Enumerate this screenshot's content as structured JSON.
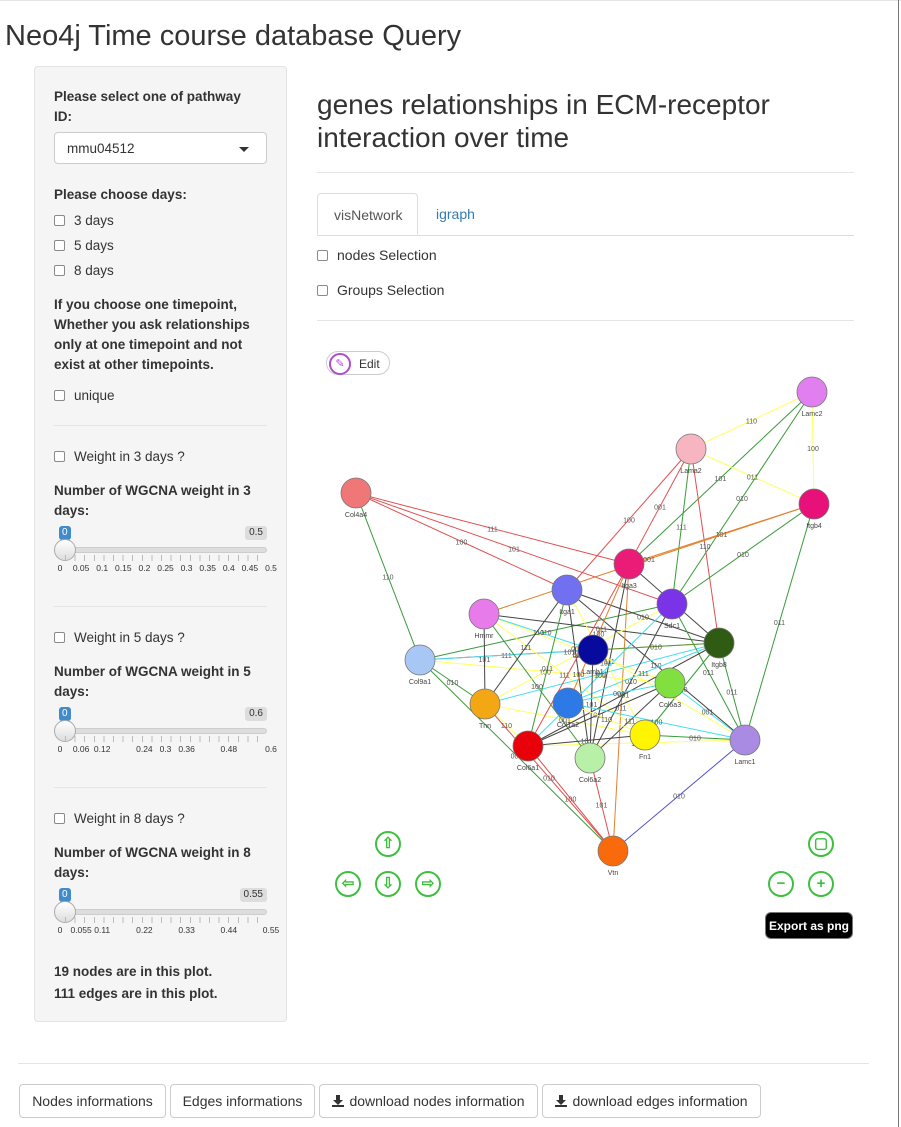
{
  "app": {
    "title": "Neo4j Time course database Query"
  },
  "sidebar": {
    "pathway_label": "Please select one of pathway ID:",
    "pathway_value": "mmu04512",
    "days_label": "Please choose days:",
    "days": [
      "3 days",
      "5 days",
      "8 days"
    ],
    "unique_note": "If you choose one timepoint, Whether you ask relationships only at one timepoint and not exist at other timepoints.",
    "unique_label": "unique",
    "weights": [
      {
        "checkbox": "Weight in 3 days ?",
        "label": "Number of WGCNA weight in 3 days:",
        "min": "0",
        "max": "0.5",
        "ticks": [
          "0",
          "0.05",
          "0.1",
          "0.15",
          "0.2",
          "0.25",
          "0.3",
          "0.35",
          "0.4",
          "0.45",
          "0.5"
        ]
      },
      {
        "checkbox": "Weight in 5 days ?",
        "label": "Number of WGCNA weight in 5 days:",
        "min": "0",
        "max": "0.6",
        "ticks": [
          "0",
          "0.06",
          "0.12",
          "0.24",
          "0.3",
          "0.36",
          "0.48",
          "0.6"
        ]
      },
      {
        "checkbox": "Weight in 8 days ?",
        "label": "Number of WGCNA weight in 8 days:",
        "min": "0",
        "max": "0.55",
        "ticks": [
          "0",
          "0.055",
          "0.11",
          "0.22",
          "0.33",
          "0.44",
          "0.55"
        ]
      }
    ],
    "nodes_stat": "19 nodes are in this plot.",
    "edges_stat": "111 edges are in this plot."
  },
  "main": {
    "heading": "genes relationships in ECM-receptor interaction over time",
    "tabs": [
      "visNetwork",
      "igraph"
    ],
    "nodes_selection": "nodes Selection",
    "groups_selection": "Groups Selection",
    "edit_label": "Edit",
    "export_label": "Export as png"
  },
  "network": {
    "nodes": [
      {
        "id": "Lamc2",
        "color": "#e27ff0"
      },
      {
        "id": "Lama2",
        "color": "#f7b5c2"
      },
      {
        "id": "Itgb4",
        "color": "#e8117a"
      },
      {
        "id": "Col4a4",
        "color": "#f07777"
      },
      {
        "id": "Itga3",
        "color": "#ea1c78"
      },
      {
        "id": "Itga?",
        "color": "#7070f0"
      },
      {
        "id": "Sdc1",
        "color": "#7b33e8"
      },
      {
        "id": "Hmmr",
        "color": "#e77be9"
      },
      {
        "id": "Itgb8",
        "color": "#2f5c12"
      },
      {
        "id": "Col9a1",
        "color": "#a9c7f5"
      },
      {
        "id": "Lamb1",
        "color": "#070a9c"
      },
      {
        "id": "Col6a3",
        "color": "#81e040"
      },
      {
        "id": "Tnn",
        "color": "#f3a714"
      },
      {
        "id": "Col1a2",
        "color": "#2d7ae7"
      },
      {
        "id": "Fn1",
        "color": "#fff402"
      },
      {
        "id": "Lamc1",
        "color": "#a98be4"
      },
      {
        "id": "Col6a1",
        "color": "#e8000b"
      },
      {
        "id": "Col6a2",
        "color": "#b8f0a8"
      },
      {
        "id": "Vtn",
        "color": "#f96a0d"
      }
    ],
    "edge_labels": [
      "110",
      "100",
      "101",
      "010",
      "011",
      "001",
      "111"
    ]
  },
  "bottom_buttons": {
    "nodes_info": "Nodes informations",
    "edges_info": "Edges informations",
    "download_nodes": "download nodes information",
    "download_edges": "download edges information"
  }
}
